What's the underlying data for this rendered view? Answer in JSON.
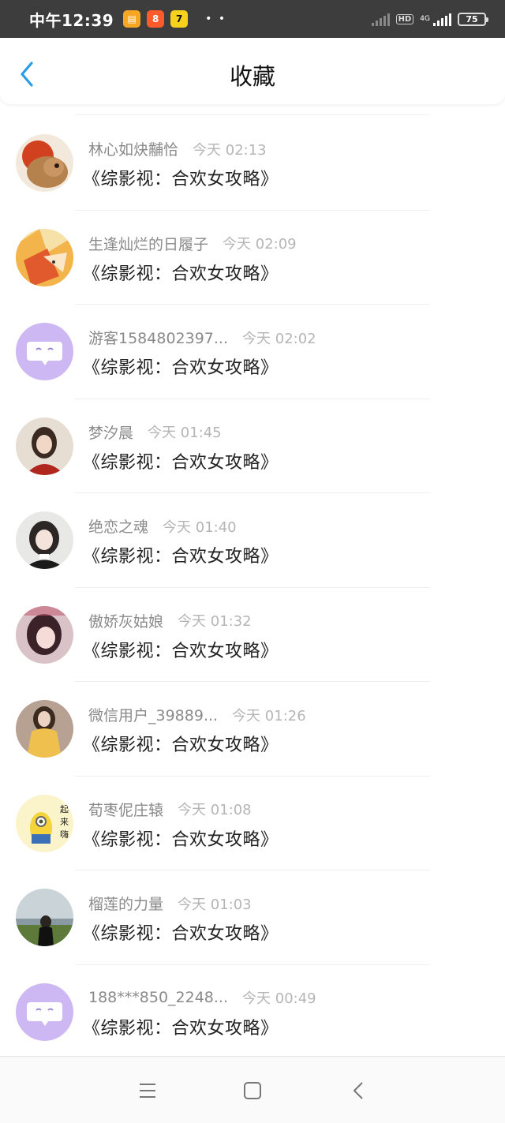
{
  "status_bar": {
    "time": "中午12:39",
    "battery": "75",
    "network": "4G",
    "hd": "HD"
  },
  "header": {
    "title": "收藏",
    "back_icon": "chevron-left-icon"
  },
  "accent_color": "#2a9ce8",
  "items": [
    {
      "name": "林心如炔黼恰",
      "time": "今天 02:13",
      "book": "《综影视：合欢女攻略》"
    },
    {
      "name": "生逢灿烂的日履子",
      "time": "今天 02:09",
      "book": "《综影视：合欢女攻略》"
    },
    {
      "name": "游客1584802397...",
      "time": "今天 02:02",
      "book": "《综影视：合欢女攻略》"
    },
    {
      "name": "梦汐晨",
      "time": "今天 01:45",
      "book": "《综影视：合欢女攻略》"
    },
    {
      "name": "绝恋之魂",
      "time": "今天 01:40",
      "book": "《综影视：合欢女攻略》"
    },
    {
      "name": "傲娇灰姑娘",
      "time": "今天 01:32",
      "book": "《综影视：合欢女攻略》"
    },
    {
      "name": "微信用户_39889...",
      "time": "今天 01:26",
      "book": "《综影视：合欢女攻略》"
    },
    {
      "name": "荀枣伲庄辕",
      "time": "今天 01:08",
      "book": "《综影视：合欢女攻略》"
    },
    {
      "name": "榴莲的力量",
      "time": "今天 01:03",
      "book": "《综影视：合欢女攻略》"
    },
    {
      "name": "188***850_2248...",
      "time": "今天 00:49",
      "book": "《综影视：合欢女攻略》"
    }
  ],
  "nav_bar": {
    "menu_icon": "menu-icon",
    "home_icon": "home-square-icon",
    "back_icon": "back-triangle-icon"
  }
}
